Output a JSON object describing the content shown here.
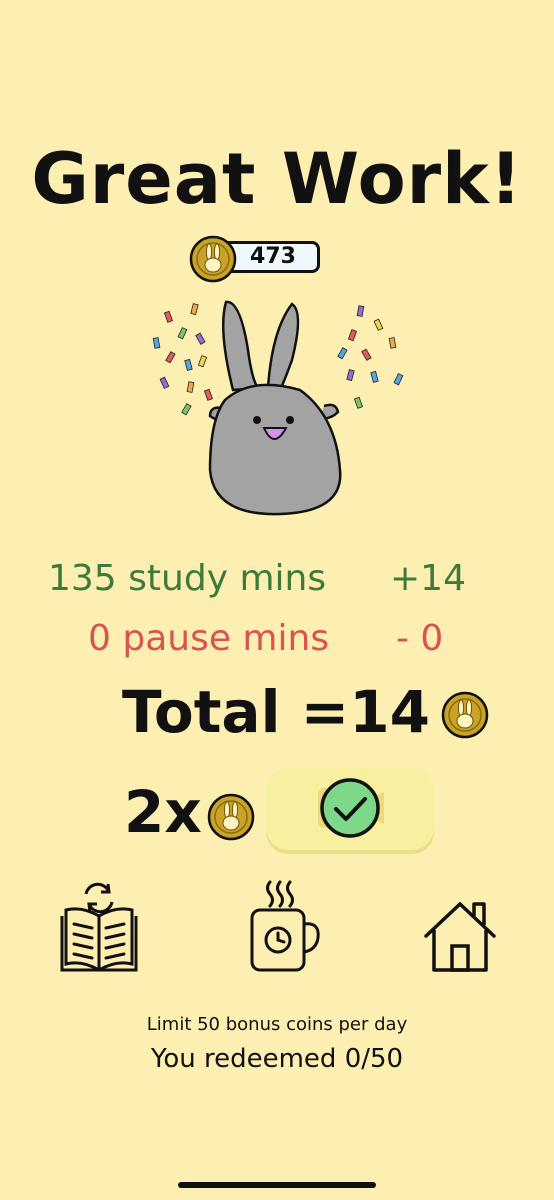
{
  "header": {
    "title": "Great Work!"
  },
  "coins": {
    "balance": "473",
    "icon": "bunny-coin-icon"
  },
  "summary": {
    "study_minutes": "135",
    "study_label": "study mins",
    "study_bonus": "+14",
    "pause_minutes": "0",
    "pause_label": "pause mins",
    "pause_bonus": "- 0",
    "total_label": "Total =14",
    "multiplier_label": "2x"
  },
  "nav": {
    "items": [
      {
        "name": "study-again",
        "icon": "book-refresh-icon"
      },
      {
        "name": "break",
        "icon": "coffee-clock-icon"
      },
      {
        "name": "home",
        "icon": "house-icon"
      }
    ]
  },
  "footer": {
    "limit_text": "Limit 50 bonus coins per day",
    "redeemed_text": "You redeemed 0/50"
  },
  "colors": {
    "background": "#fdefb2",
    "study_green": "#3d7a3d",
    "pause_red": "#d9534f",
    "coin_gold": "#c9a227",
    "button_yellow": "#f6f0a0",
    "check_green": "#7dd88a"
  }
}
